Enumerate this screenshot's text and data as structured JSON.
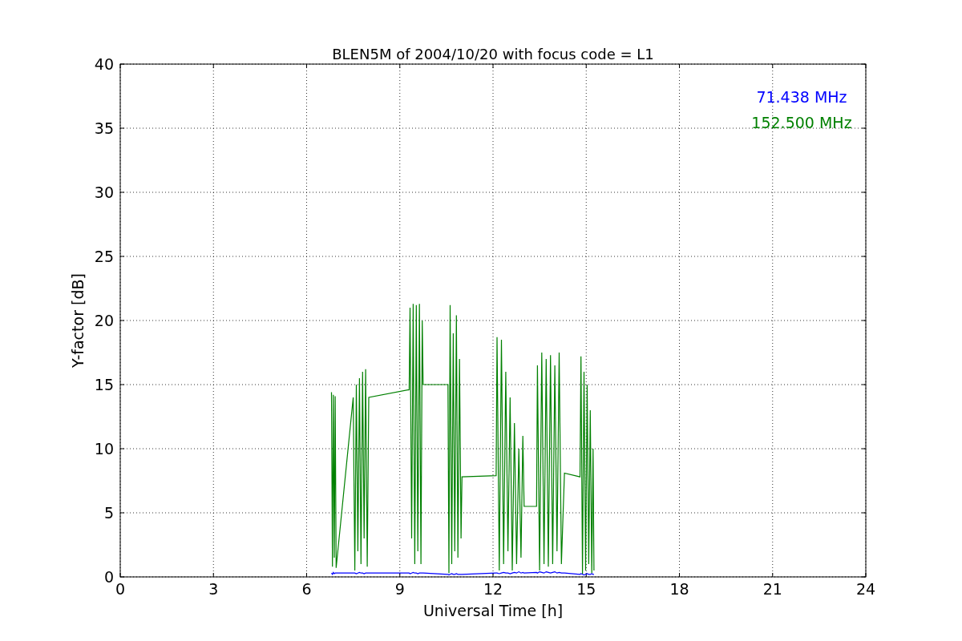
{
  "chart_data": {
    "type": "line",
    "title": "BLEN5M of 2004/10/20 with focus code = L1",
    "xlabel": "Universal Time [h]",
    "ylabel": "Y-factor [dB]",
    "grid": true,
    "xlim": [
      0,
      24
    ],
    "ylim": [
      0,
      40
    ],
    "xticks": [
      0,
      3,
      6,
      9,
      12,
      15,
      18,
      21,
      24
    ],
    "yticks": [
      0,
      5,
      10,
      15,
      20,
      25,
      30,
      35,
      40
    ],
    "x": [
      6.8,
      6.83,
      6.86,
      6.89,
      6.92,
      6.95,
      7.5,
      7.55,
      7.6,
      7.65,
      7.7,
      7.75,
      7.8,
      7.85,
      7.9,
      7.95,
      8.0,
      9.3,
      9.33,
      9.38,
      9.43,
      9.48,
      9.53,
      9.58,
      9.63,
      9.68,
      9.72,
      9.75,
      10.55,
      10.58,
      10.62,
      10.67,
      10.72,
      10.77,
      10.82,
      10.87,
      10.92,
      10.97,
      11.0,
      12.1,
      12.13,
      12.2,
      12.27,
      12.34,
      12.41,
      12.48,
      12.55,
      12.62,
      12.69,
      12.76,
      12.83,
      12.9,
      12.96,
      13.0,
      13.4,
      13.43,
      13.5,
      13.57,
      13.64,
      13.71,
      13.78,
      13.85,
      13.92,
      13.99,
      14.06,
      14.13,
      14.2,
      14.3,
      14.8,
      14.83,
      14.88,
      14.93,
      14.98,
      15.03,
      15.08,
      15.13,
      15.18,
      15.22,
      15.25
    ],
    "series": [
      {
        "name": "71.438 MHz",
        "color": "#0000ff",
        "values": [
          0.3,
          0.2,
          0.35,
          0.25,
          0.3,
          0.3,
          0.3,
          0.3,
          0.25,
          0.3,
          0.35,
          0.3,
          0.3,
          0.25,
          0.3,
          0.3,
          0.3,
          0.3,
          0.25,
          0.3,
          0.35,
          0.3,
          0.3,
          0.25,
          0.3,
          0.3,
          0.3,
          0.3,
          0.2,
          0.15,
          0.2,
          0.25,
          0.2,
          0.2,
          0.25,
          0.2,
          0.2,
          0.2,
          0.2,
          0.3,
          0.3,
          0.25,
          0.3,
          0.35,
          0.3,
          0.3,
          0.25,
          0.3,
          0.35,
          0.3,
          0.4,
          0.3,
          0.35,
          0.3,
          0.35,
          0.3,
          0.4,
          0.35,
          0.3,
          0.4,
          0.35,
          0.3,
          0.35,
          0.4,
          0.3,
          0.35,
          0.3,
          0.3,
          0.2,
          0.25,
          0.2,
          0.15,
          0.2,
          0.25,
          0.2,
          0.2,
          0.25,
          0.2,
          0.2
        ]
      },
      {
        "name": "152.500 MHz",
        "color": "#008000",
        "values": [
          14.4,
          0.8,
          14.2,
          1.5,
          14.1,
          0.7,
          14,
          0.5,
          15,
          2,
          15.5,
          1,
          16,
          3,
          16.2,
          0.8,
          14,
          14.6,
          21,
          3,
          21.3,
          1,
          21.2,
          2,
          21.3,
          1,
          20,
          15,
          15,
          0.3,
          21.2,
          1,
          19,
          2,
          20.4,
          1.5,
          17,
          3,
          7.8,
          7.9,
          18.7,
          0.5,
          18.5,
          1,
          16,
          2,
          14,
          0.5,
          12,
          1,
          10,
          1.5,
          11,
          5.5,
          5.5,
          16.5,
          0.5,
          17.5,
          1,
          17,
          0.8,
          17.3,
          1,
          16.5,
          2,
          17.5,
          1,
          8.1,
          7.8,
          17.2,
          0.2,
          16,
          0.5,
          15,
          1,
          13,
          0.3,
          10,
          0.5
        ]
      }
    ]
  }
}
